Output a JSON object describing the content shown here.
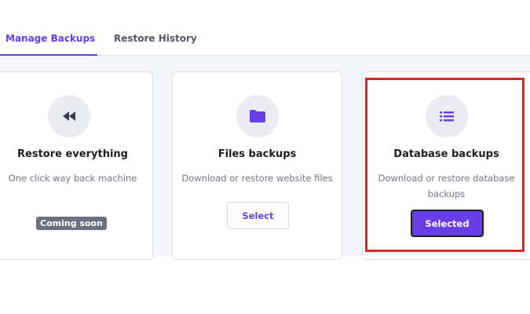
{
  "tabs": [
    {
      "label": "Manage Backups",
      "active": true
    },
    {
      "label": "Restore History",
      "active": false
    }
  ],
  "cards": [
    {
      "title": "Restore everything",
      "description": "One click way back machine",
      "icon": "rewind-icon",
      "badge": "Coming soon"
    },
    {
      "title": "Files backups",
      "description": "Download or restore website files",
      "icon": "folder-icon",
      "button": "Select"
    },
    {
      "title": "Database backups",
      "description": "Download or restore database backups",
      "icon": "list-icon",
      "button": "Selected",
      "highlighted": true
    }
  ],
  "colors": {
    "accent": "#673de6",
    "highlight": "#e02424",
    "badge": "#6d7081"
  }
}
